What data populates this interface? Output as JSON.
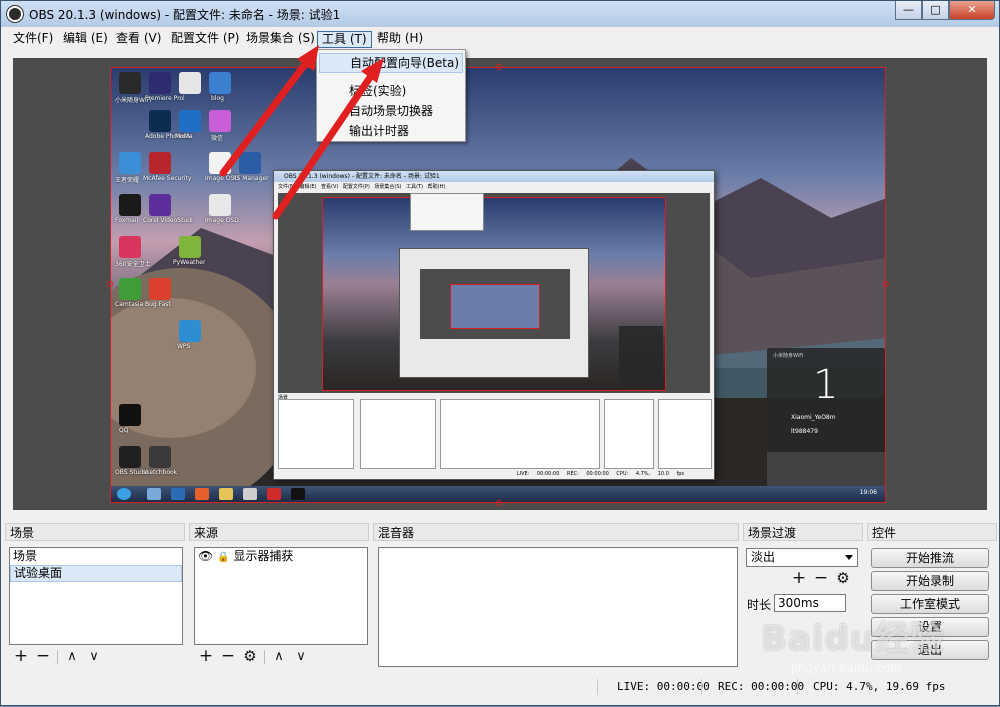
{
  "window": {
    "title": "OBS 20.1.3 (windows) - 配置文件: 未命名 - 场景: 试验1",
    "minimize": "—",
    "maximize": "□",
    "close": "✕"
  },
  "menubar": {
    "items": [
      "文件(F)",
      "编辑 (E)",
      "查看 (V)",
      "配置文件 (P)",
      "场景集合 (S)",
      "工具 (T)",
      "帮助 (H)"
    ],
    "active_index": 5
  },
  "tools_menu": {
    "items": [
      "自动配置向导(Beta)",
      "标签(实验)",
      "自动场景切换器",
      "输出计时器"
    ],
    "highlighted_index": 0
  },
  "preview": {
    "desktop_icons": [
      "小米随身WiFi",
      "Premiere Pro",
      "l",
      "blog",
      "Adobe Photosh",
      "MoMa",
      "微信",
      "McAfee Security",
      "王者荣耀",
      "Image OSD",
      "IIS Manager",
      "Corel VideoStudi",
      "Foxmail",
      "Image OSD",
      "360安全卫士",
      "PyWeather",
      "Camtasia",
      "Bug Fast",
      "WPS",
      "QQ",
      "sketchbook",
      "OBS Studio"
    ],
    "phone_card": {
      "title": "小米随身WiFi",
      "number": "1",
      "line1": "Xiaomi_YeO8m",
      "line2": "lt988479"
    },
    "nested_window_title": "OBS 20.1.3 (windows) - 配置文件: 未命名 - 场景: 试验1",
    "nested_menu": "文件(F) 编辑(E) 查看(V) 配置文件(P) 场景集合(S) 工具(T) 帮助(H)",
    "nested_status": "LIVE: 00:00:00 REC: 00:00:00 CPU: 4.7%, 10.0 fps",
    "taskbar_time": "19:06"
  },
  "docks": {
    "scenes": {
      "header": "场景",
      "items": [
        "场景",
        "试验桌面"
      ],
      "selected_index": 1
    },
    "sources": {
      "header": "来源",
      "items": [
        "显示器捕获"
      ],
      "eye_icon": "eye-icon",
      "lock_icon": "lock-icon"
    },
    "mixer": {
      "header": "混音器"
    },
    "transitions": {
      "header": "场景过渡",
      "selected": "淡出",
      "duration_label": "时长",
      "duration_value": "300ms"
    },
    "controls": {
      "header": "控件",
      "buttons": [
        "开始推流",
        "开始录制",
        "工作室模式",
        "设置",
        "退出"
      ]
    }
  },
  "tools": {
    "add": "+",
    "remove": "−",
    "up": "∧",
    "down": "∨",
    "gear": "⚙"
  },
  "statusbar": {
    "live": "LIVE: 00:00:00",
    "rec": "REC: 00:00:00",
    "cpu": "CPU: 4.7%, 19.69 fps"
  },
  "watermark": {
    "text": "Baidu经验",
    "sub": "jingyan.baidu.com"
  },
  "colors": {
    "titlebar": "#b3cae6",
    "selection": "#dbe8f7",
    "capture_border": "#d42020",
    "annotation_arrow": "#e02020"
  }
}
